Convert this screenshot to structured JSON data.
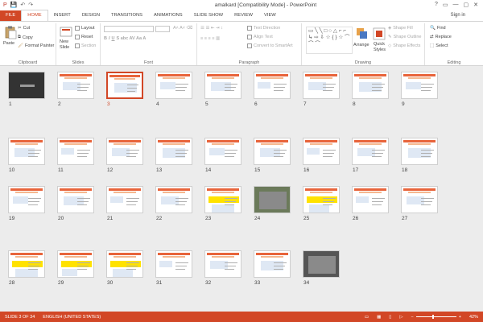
{
  "window": {
    "title": "amalkard [Compatibility Mode] - PowerPoint",
    "controls": [
      "?",
      "▭",
      "—",
      "▢",
      "✕"
    ]
  },
  "qat": {
    "save": "💾",
    "undo": "↶",
    "redo": "↷"
  },
  "tabs": [
    {
      "label": "FILE"
    },
    {
      "label": "HOME"
    },
    {
      "label": "INSERT"
    },
    {
      "label": "DESIGN"
    },
    {
      "label": "TRANSITIONS"
    },
    {
      "label": "ANIMATIONS"
    },
    {
      "label": "SLIDE SHOW"
    },
    {
      "label": "REVIEW"
    },
    {
      "label": "VIEW"
    }
  ],
  "signin": "Sign in",
  "ribbon": {
    "clipboard": {
      "label": "Clipboard",
      "paste": "Paste",
      "cut": "Cut",
      "copy": "Copy",
      "format_painter": "Format Painter"
    },
    "slides": {
      "label": "Slides",
      "new_slide_1": "New",
      "new_slide_2": "Slide",
      "layout": "Layout",
      "reset": "Reset",
      "section": "Section"
    },
    "font": {
      "label": "Font"
    },
    "paragraph": {
      "label": "Paragraph",
      "text_direction": "Text Direction",
      "align_text": "Align Text",
      "smartart": "Convert to SmartArt"
    },
    "drawing": {
      "label": "Drawing",
      "arrange": "Arrange",
      "quick_styles_1": "Quick",
      "quick_styles_2": "Styles",
      "shape_fill": "Shape Fill",
      "shape_outline": "Shape Outline",
      "shape_effects": "Shape Effects",
      "shapes_glyphs": "▭ ╲ ╲ □ ○ △ ⌐ ⌐ ↳ ⇨ ⇩ ☆ { } ☆ ⌒ ⌒ ⌒"
    },
    "editing": {
      "label": "Editing",
      "find": "Find",
      "replace": "Replace",
      "select": "Select"
    }
  },
  "slides": [
    {
      "n": "1"
    },
    {
      "n": "2"
    },
    {
      "n": "3"
    },
    {
      "n": "4"
    },
    {
      "n": "5"
    },
    {
      "n": "6"
    },
    {
      "n": "7"
    },
    {
      "n": "8"
    },
    {
      "n": "9"
    },
    {
      "n": "10"
    },
    {
      "n": "11"
    },
    {
      "n": "12"
    },
    {
      "n": "13"
    },
    {
      "n": "14"
    },
    {
      "n": "15"
    },
    {
      "n": "16"
    },
    {
      "n": "17"
    },
    {
      "n": "18"
    },
    {
      "n": "19"
    },
    {
      "n": "20"
    },
    {
      "n": "21"
    },
    {
      "n": "22"
    },
    {
      "n": "23"
    },
    {
      "n": "24"
    },
    {
      "n": "25"
    },
    {
      "n": "26"
    },
    {
      "n": "27"
    },
    {
      "n": "28"
    },
    {
      "n": "29"
    },
    {
      "n": "30"
    },
    {
      "n": "31"
    },
    {
      "n": "32"
    },
    {
      "n": "33"
    },
    {
      "n": "34"
    }
  ],
  "selected_slide": "3",
  "status": {
    "slide_of": "SLIDE 3 OF 34",
    "language": "ENGLISH (UNITED STATES)",
    "zoom": "42%",
    "zoom_fraction": 0.42
  },
  "colors": {
    "accent": "#d24726"
  }
}
